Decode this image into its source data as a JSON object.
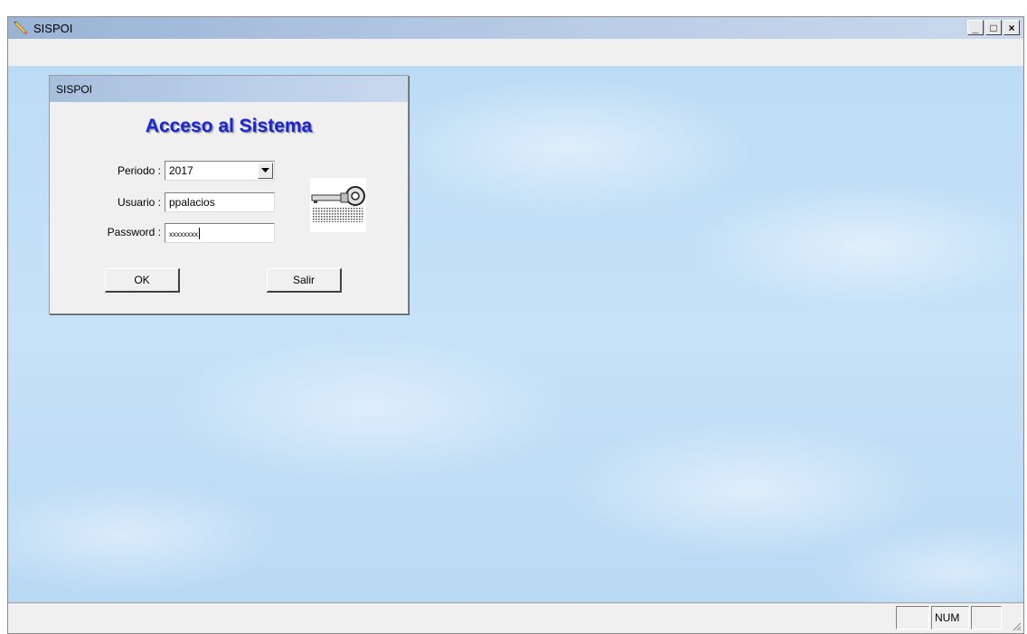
{
  "window": {
    "title": "SISPOI",
    "controls": {
      "minimize": "_",
      "maximize": "□",
      "close": "×"
    }
  },
  "dialog": {
    "title": "SISPOI",
    "heading": "Acceso al Sistema",
    "periodo_label": "Periodo :",
    "periodo_value": "2017",
    "usuario_label": "Usuario :",
    "usuario_value": "ppalacios",
    "password_label": "Password :",
    "password_mask": "xxxxxxxx",
    "ok_label": "OK",
    "salir_label": "Salir"
  },
  "statusbar": {
    "panels": [
      "",
      "NUM",
      ""
    ]
  },
  "colors": {
    "heading": "#1a25d8",
    "titlebar": "#b9cce6",
    "desktop": "#c4e0f7"
  },
  "icons": [
    "app-pencil-icon",
    "key-icon",
    "dropdown-arrow-icon",
    "resize-grip-icon"
  ]
}
